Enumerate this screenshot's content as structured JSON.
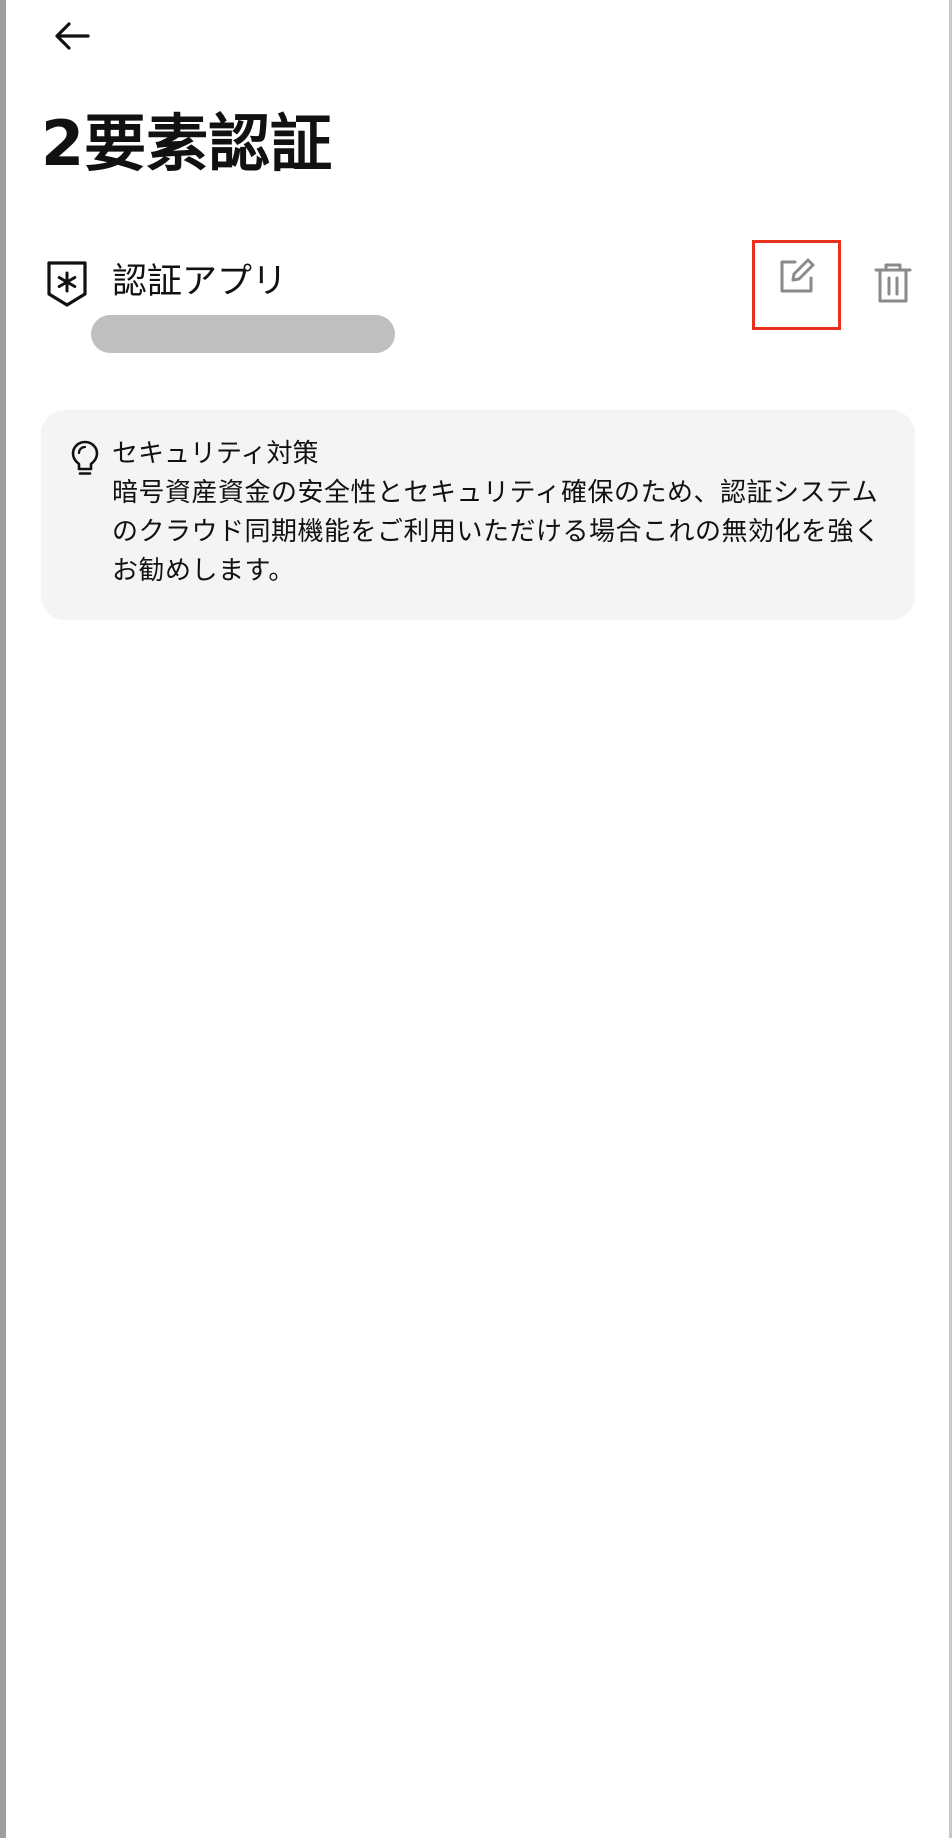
{
  "header": {
    "title": "2要素認証"
  },
  "auth_method": {
    "label": "認証アプリ",
    "value": "masked"
  },
  "security_tip": {
    "title": "セキュリティ対策",
    "lines": [
      "暗号資産資金の安全性とセキュリティ確保のため、認証システム",
      "のクラウド同期機能をご利用いただける場合これの無効化を強く",
      "お勧めします。"
    ]
  },
  "icons": {
    "back": "arrow-left-icon",
    "auth_app": "shield-asterisk-icon",
    "edit": "edit-pencil-icon",
    "delete": "trash-icon",
    "tip": "lightbulb-icon"
  },
  "colors": {
    "highlight_border": "#e8321e",
    "card_background": "#f4f4f4",
    "mask": "#bfbfbf",
    "action_icon": "#8a8a8a"
  }
}
